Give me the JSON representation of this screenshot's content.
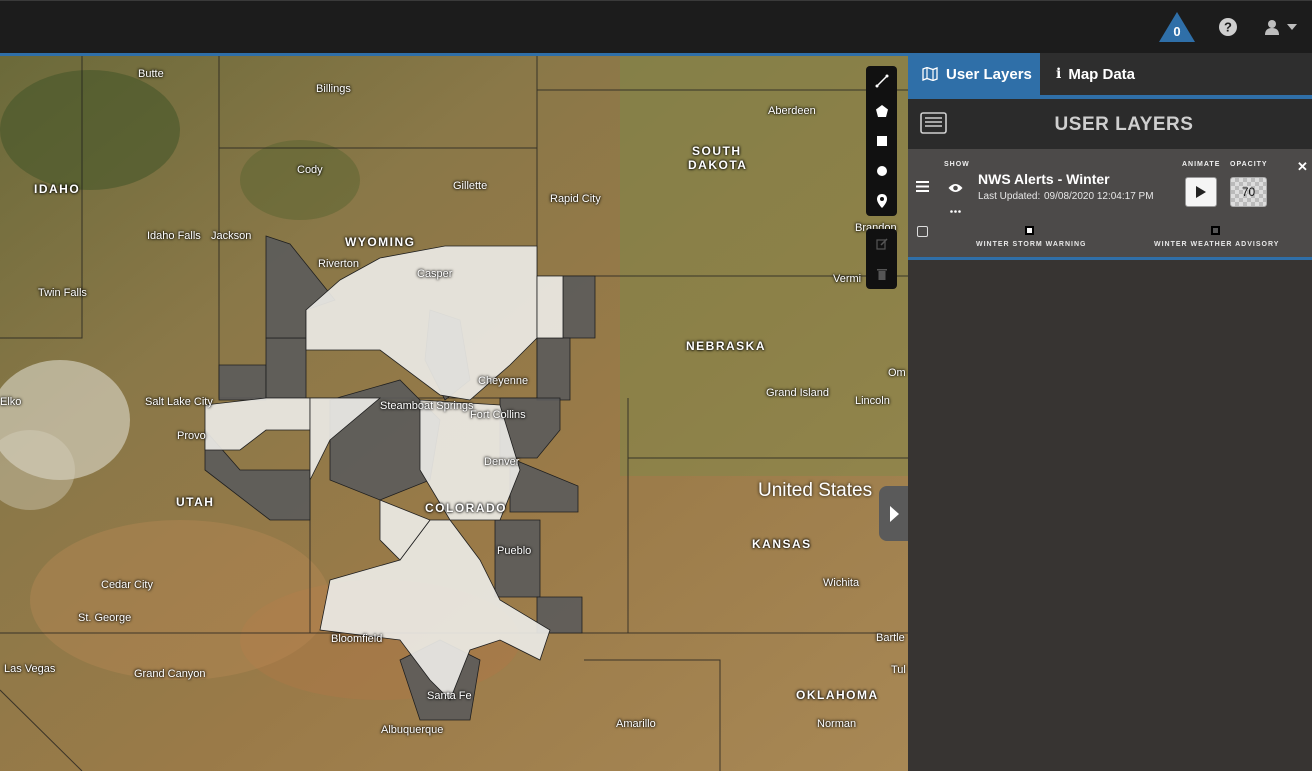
{
  "topbar": {
    "alert_count": "0",
    "icons": [
      "alert-triangle-icon",
      "help-circle-icon",
      "user-icon",
      "caret-down-icon"
    ]
  },
  "map": {
    "country_label": "United States",
    "state_labels": [
      "IDAHO",
      "WYOMING",
      "SOUTH",
      "DAKOTA",
      "NEBRASKA",
      "UTAH",
      "COLORADO",
      "KANSAS",
      "OKLAHOMA"
    ],
    "city_labels": [
      "Butte",
      "Billings",
      "Aberdeen",
      "Cody",
      "Gillette",
      "Rapid City",
      "Idaho Falls",
      "Jackson",
      "Riverton",
      "Casper",
      "Brandon",
      "Twin Falls",
      "Vermi",
      "Salt Lake City",
      "Steamboat Springs",
      "Fort Collins",
      "Cheyenne",
      "Denver",
      "Grand Island",
      "Lincoln",
      "Om",
      "Provo",
      "Pueblo",
      "Cedar City",
      "St. George",
      "Bloomfield",
      "Wichita",
      "Las Vegas",
      "Grand Canyon",
      "Santa Fe",
      "Albuquerque",
      "Amarillo",
      "Norman",
      "Bartle",
      "Tul",
      "Elko"
    ],
    "colors": {
      "accent": "#2f6fa8",
      "warning_fill": "#ededea",
      "advisory_fill": "#5a5a5a"
    }
  },
  "tools": {
    "draw": [
      "line-tool-icon",
      "polygon-tool-icon",
      "rectangle-tool-icon",
      "circle-tool-icon",
      "marker-tool-icon"
    ],
    "edit": [
      "edit-tool-icon",
      "trash-tool-icon"
    ]
  },
  "panel": {
    "tabs": [
      {
        "label": "User Layers",
        "icon": "map-icon",
        "active": true
      },
      {
        "label": "Map Data",
        "icon": "info-icon",
        "active": false
      }
    ],
    "title": "USER LAYERS",
    "layer": {
      "show_label": "SHOW",
      "animate_label": "ANIMATE",
      "opacity_label": "OPACITY",
      "name": "NWS Alerts - Winter",
      "updated_label": "Last Updated:",
      "updated_value": "09/08/2020 12:04:17 PM",
      "opacity_value": "70",
      "legend": [
        {
          "label": "WINTER STORM WARNING",
          "color": "#ffffff"
        },
        {
          "label": "WINTER WEATHER ADVISORY",
          "color": "#555555"
        }
      ]
    }
  }
}
